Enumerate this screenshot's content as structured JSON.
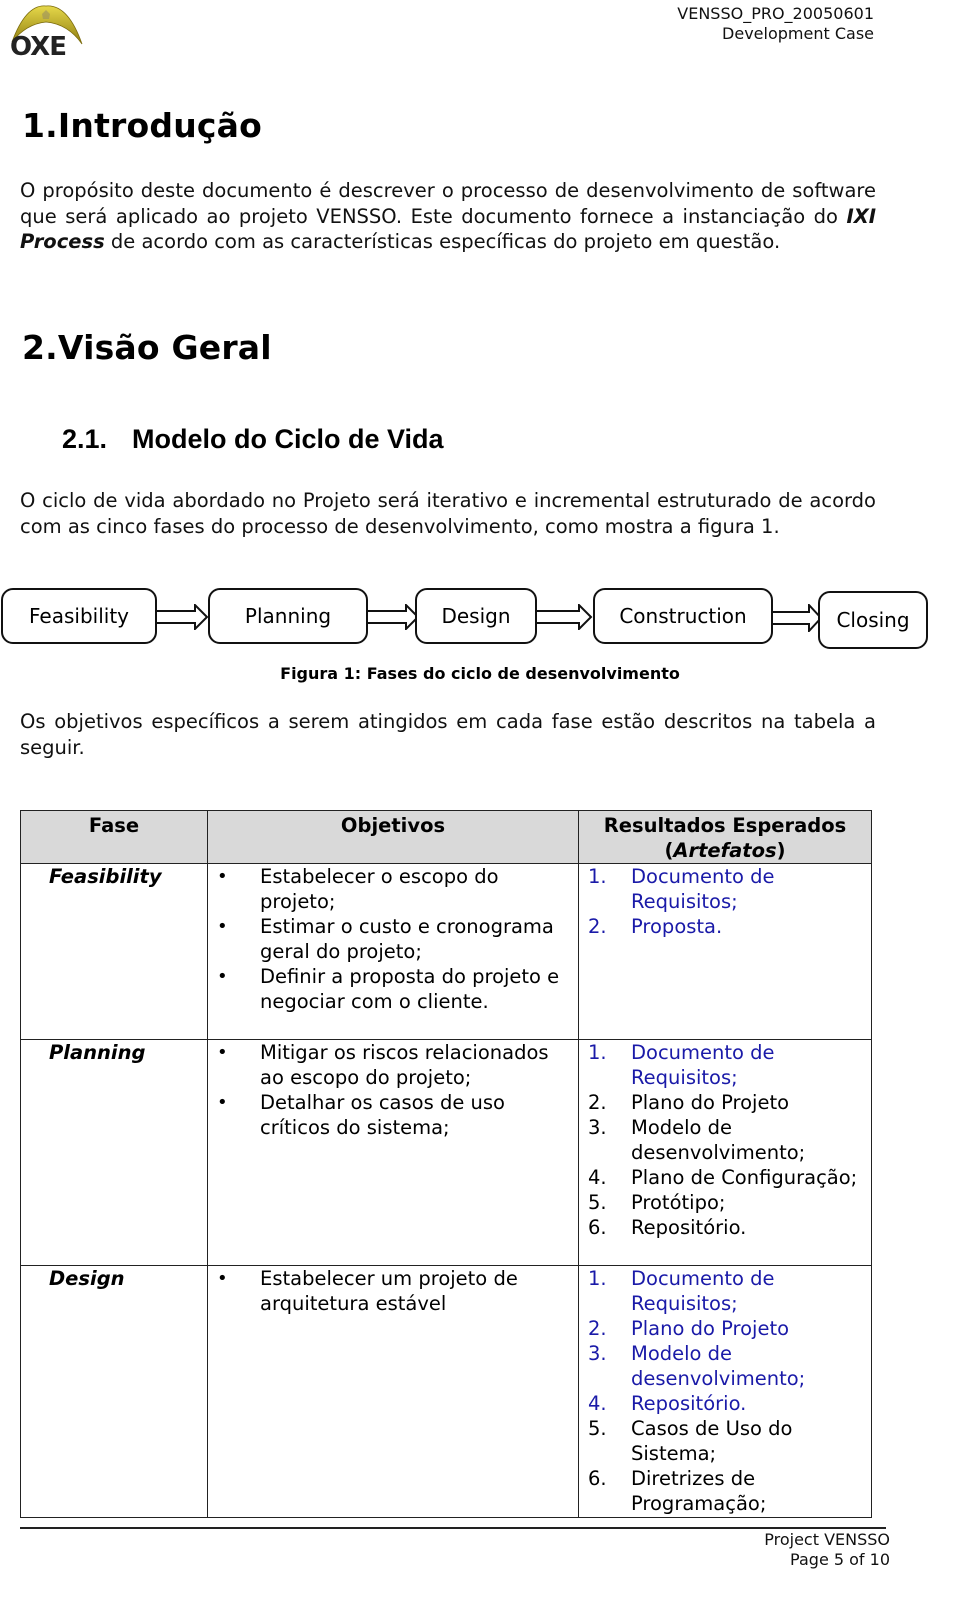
{
  "header": {
    "logo_text": "OXE",
    "doc_id": "VENSSO_PRO_20050601",
    "doc_type": "Development Case"
  },
  "sections": {
    "intro": {
      "number": "1.",
      "title": "Introdução",
      "para_part1": "O propósito deste documento é descrever o processo de desenvolvimento de software que será aplicado ao projeto VENSSO. Este documento fornece a instanciação do ",
      "para_emphasis": "IXI Process",
      "para_part2": " de acordo com as características específicas do projeto em questão."
    },
    "overview": {
      "number": "2.",
      "title": "Visão Geral"
    },
    "lifecycle": {
      "number": "2.1.",
      "title": "Modelo do Ciclo de Vida",
      "para": "O ciclo de vida abordado no Projeto será iterativo e incremental estruturado de acordo com as cinco fases do processo de desenvolvimento, como mostra a figura 1.",
      "figure_caption": "Figura 1: Fases do ciclo de desenvolvimento",
      "phases": [
        "Feasibility",
        "Planning",
        "Design",
        "Construction",
        "Closing"
      ],
      "table_intro": "Os objetivos específicos a serem atingidos em cada fase estão descritos na tabela a seguir."
    }
  },
  "table": {
    "headers": {
      "fase": "Fase",
      "objetivos": "Objetivos",
      "resultados": "Resultados Esperados",
      "resultados_sub_open": "(",
      "resultados_sub": "Artefatos",
      "resultados_sub_close": ")"
    },
    "rows": [
      {
        "fase": "Feasibility",
        "objetivos": [
          "Estabelecer o escopo do projeto;",
          "Estimar o custo e cronograma geral do projeto;",
          "Definir a proposta do projeto e negociar com o cliente."
        ],
        "resultados": [
          {
            "n": "1.",
            "text": "Documento de Requisitos;",
            "link": true
          },
          {
            "n": "2.",
            "text": "Proposta.",
            "link": true
          }
        ]
      },
      {
        "fase": "Planning",
        "objetivos": [
          "Mitigar os riscos relacionados ao escopo do projeto;",
          "Detalhar os casos de uso críticos do sistema;"
        ],
        "resultados": [
          {
            "n": "1.",
            "text": "Documento de Requisitos;",
            "link": true
          },
          {
            "n": "2.",
            "text": "Plano do Projeto",
            "link": false
          },
          {
            "n": "3.",
            "text": "Modelo de desenvolvimento;",
            "link": false
          },
          {
            "n": "4.",
            "text": "Plano de Configuração;",
            "link": false
          },
          {
            "n": "5.",
            "text": "Protótipo;",
            "link": false
          },
          {
            "n": "6.",
            "text": "Repositório.",
            "link": false
          }
        ]
      },
      {
        "fase": "Design",
        "objetivos": [
          "Estabelecer um projeto de arquitetura estável"
        ],
        "resultados": [
          {
            "n": "1.",
            "text": "Documento de Requisitos;",
            "link": true
          },
          {
            "n": "2.",
            "text": "Plano do Projeto",
            "link": true
          },
          {
            "n": "3.",
            "text": "Modelo de desenvolvimento;",
            "link": true
          },
          {
            "n": "4.",
            "text": "Repositório.",
            "link": true
          },
          {
            "n": "5.",
            "text": "Casos de Uso do Sistema;",
            "link": false
          },
          {
            "n": "6.",
            "text": "Diretrizes de Programação;",
            "link": false
          }
        ]
      }
    ]
  },
  "footer": {
    "project": "Project VENSSO",
    "page": "Page 5 of 10"
  },
  "colors": {
    "link_blue": "#1a1aa8",
    "header_gray": "#d9d9d9",
    "logo_gold": "#c9b21a"
  }
}
